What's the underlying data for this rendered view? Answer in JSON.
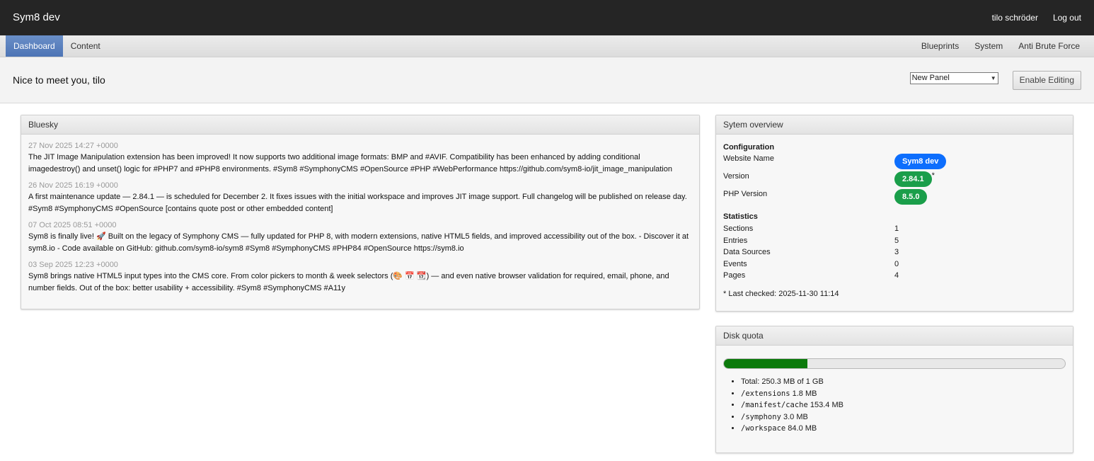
{
  "app": {
    "brand": "Sym8 dev"
  },
  "topbar": {
    "user": "tilo schröder",
    "logout": "Log out"
  },
  "nav": {
    "left": [
      {
        "label": "Dashboard"
      },
      {
        "label": "Content"
      }
    ],
    "right": [
      {
        "label": "Blueprints"
      },
      {
        "label": "System"
      },
      {
        "label": "Anti Brute Force"
      }
    ]
  },
  "header": {
    "greeting": "Nice to meet you, tilo",
    "panel_select": "New Panel",
    "enable_editing": "Enable Editing"
  },
  "bluesky": {
    "title": "Bluesky",
    "posts": [
      {
        "date": "27 Nov 2025 14:27 +0000",
        "text": "The JIT Image Manipulation extension has been improved! It now supports two additional image formats: BMP and #AVIF. Compatibility has been enhanced by adding conditional imagedestroy() and unset() logic for #PHP7 and #PHP8 environments. #Sym8 #SymphonyCMS #OpenSource #PHP #WebPerformance https://github.com/sym8-io/jit_image_manipulation"
      },
      {
        "date": "26 Nov 2025 16:19 +0000",
        "text": "A first maintenance update — 2.84.1 — is scheduled for December 2. It fixes issues with the initial workspace and improves JIT image support. Full changelog will be published on release day. #Sym8 #SymphonyCMS #OpenSource [contains quote post or other embedded content]"
      },
      {
        "date": "07 Oct 2025 08:51 +0000",
        "text": "Sym8 is finally live! 🚀 Built on the legacy of Symphony CMS — fully updated for PHP 8, with modern extensions, native HTML5 fields, and improved accessibility out of the box. - Discover it at sym8.io - Code available on GitHub: github.com/sym8-io/sym8 #Sym8 #SymphonyCMS #PHP84 #OpenSource https://sym8.io"
      },
      {
        "date": "03 Sep 2025 12:23 +0000",
        "text": "Sym8 brings native HTML5 input types into the CMS core. From color pickers to month & week selectors (🎨 📅 📆) — and even native browser validation for required, email, phone, and number fields. Out of the box: better usability + accessibility. #Sym8 #SymphonyCMS #A11y"
      }
    ]
  },
  "overview": {
    "title": "Sytem overview",
    "configuration_title": "Configuration",
    "website_name_label": "Website Name",
    "website_name": "Sym8 dev",
    "version_label": "Version",
    "version": "2.84.1",
    "version_mark": "*",
    "php_label": "PHP Version",
    "php": "8.5.0",
    "statistics_title": "Statistics",
    "stats": [
      {
        "label": "Sections",
        "value": "1"
      },
      {
        "label": "Entries",
        "value": "5"
      },
      {
        "label": "Data Sources",
        "value": "3"
      },
      {
        "label": "Events",
        "value": "0"
      },
      {
        "label": "Pages",
        "value": "4"
      }
    ],
    "last_checked": "* Last checked: 2025-11-30 11:14"
  },
  "disk": {
    "title": "Disk quota",
    "used_fraction": 0.245,
    "total": "Total: 250.3 MB of 1 GB",
    "items": [
      {
        "path": "/extensions",
        "size": "1.8 MB"
      },
      {
        "path": "/manifest/cache",
        "size": "153.4 MB"
      },
      {
        "path": "/symphony",
        "size": "3.0 MB"
      },
      {
        "path": "/workspace",
        "size": "84.0 MB"
      }
    ]
  },
  "colors": {
    "topbar": "#252525",
    "nav_active": "#5a80bf",
    "pill_blue": "#0d6efd",
    "pill_green": "#1a9e4a",
    "quota_fill": "#0c7a0c"
  }
}
